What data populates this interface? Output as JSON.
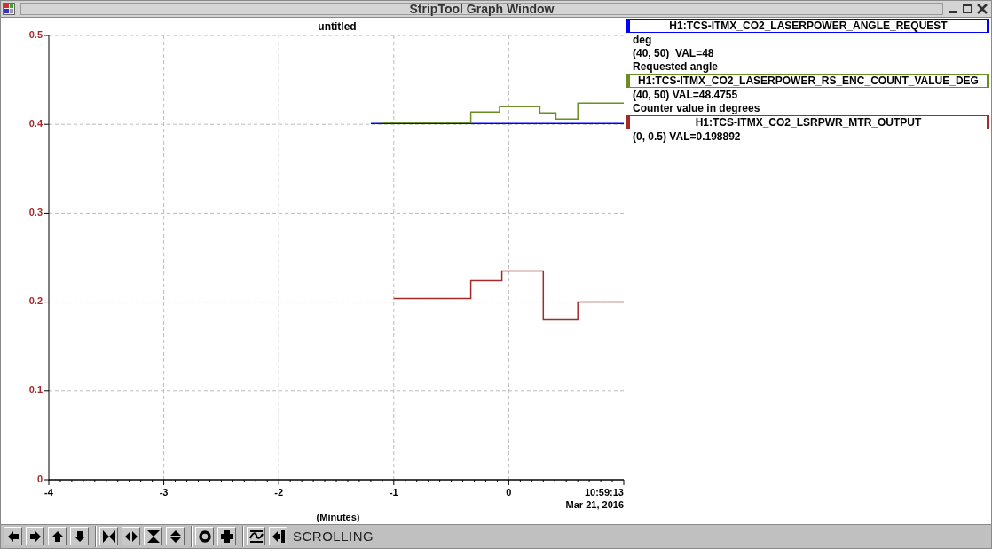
{
  "window": {
    "title": "StripTool Graph Window"
  },
  "graph": {
    "chart_data": {
      "type": "line",
      "title": "untitled",
      "xlabel": "(Minutes)",
      "xlim": [
        -4,
        1
      ],
      "ylim": [
        0,
        0.5
      ],
      "grid": true,
      "xticks": [
        -4,
        -3,
        -2,
        -1,
        0
      ],
      "yticks": [
        {
          "value": 0,
          "label": "0"
        },
        {
          "value": 0.1,
          "label": "0.1"
        },
        {
          "value": 0.2,
          "label": "0.2"
        },
        {
          "value": 0.3,
          "label": "0.3"
        },
        {
          "value": 0.4,
          "label": "0.4"
        },
        {
          "value": 0.5,
          "label": "0.5"
        }
      ],
      "x": [
        -1.2,
        -1.1,
        -1.0,
        -0.33,
        -0.33,
        -0.08,
        -0.08,
        -0.06,
        -0.06,
        0.27,
        0.27,
        0.3,
        0.3,
        0.41,
        0.41,
        0.6,
        0.6,
        1
      ],
      "series": [
        {
          "name": "H1:TCS-ITMX_CO2_LASERPOWER_ANGLE_REQUEST",
          "color": "#0000ff",
          "values": [
            0.401,
            0.401,
            0.401,
            0.401,
            0.401,
            0.401,
            0.401,
            0.401,
            0.401,
            0.401,
            0.401,
            0.401,
            0.401,
            0.401,
            0.401,
            0.401,
            0.401,
            0.401
          ]
        },
        {
          "name": "H1:TCS-ITMX_CO2_LASERPOWER_RS_ENC_COUNT_VALUE_DEG",
          "color": "#6b8e23",
          "values": [
            null,
            0.402,
            0.402,
            0.402,
            0.414,
            0.414,
            0.42,
            0.42,
            0.42,
            0.42,
            0.413,
            0.413,
            0.413,
            0.413,
            0.406,
            0.406,
            0.424,
            0.424
          ]
        },
        {
          "name": "H1:TCS-ITMX_CO2_LSRPWR_MTR_OUTPUT",
          "color": "#a52a2a",
          "values": [
            null,
            null,
            0.204,
            0.204,
            0.224,
            0.224,
            0.224,
            0.224,
            0.235,
            0.235,
            0.235,
            0.235,
            0.18,
            0.18,
            0.18,
            0.18,
            0.2,
            0.2
          ]
        }
      ]
    },
    "time_label": "10:59:13",
    "date_label": "Mar 21, 2016"
  },
  "legend": [
    {
      "lines": [
        "deg",
        "(40, 50)  VAL=48",
        "Requested angle"
      ]
    },
    {
      "lines": [
        "(40, 50) VAL=48.4755",
        "Counter value in degrees"
      ]
    },
    {
      "lines": [
        "(0, 0.5) VAL=0.198892"
      ]
    }
  ],
  "toolbar": {
    "mode": "SCROLLING"
  }
}
